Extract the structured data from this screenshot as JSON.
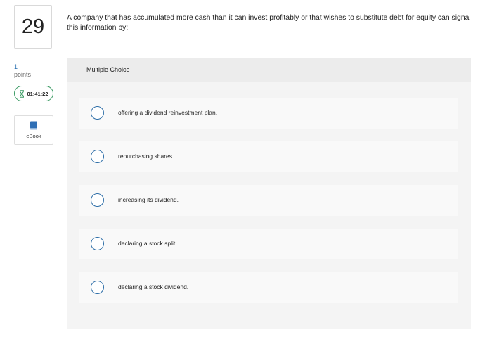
{
  "question": {
    "number": "29",
    "text": "A company that has accumulated more cash than it can invest profitably or that wishes to substitute debt for equity can signal this information by:"
  },
  "sidebar": {
    "points_value": "1",
    "points_label": "points",
    "timer": "01:41:22",
    "ebook_label": "eBook"
  },
  "panel": {
    "header": "Multiple Choice",
    "options": [
      {
        "label": "offering a dividend reinvestment plan."
      },
      {
        "label": "repurchasing shares."
      },
      {
        "label": "increasing its dividend."
      },
      {
        "label": "declaring a stock split."
      },
      {
        "label": "declaring a stock dividend."
      }
    ]
  },
  "colors": {
    "radio_border": "#2f6fa8",
    "timer_border": "#3a9a63",
    "panel_bg": "#f4f4f4",
    "points_value": "#2a6fb0"
  },
  "icons": {
    "timer": "hourglass-icon",
    "ebook": "book-icon"
  }
}
